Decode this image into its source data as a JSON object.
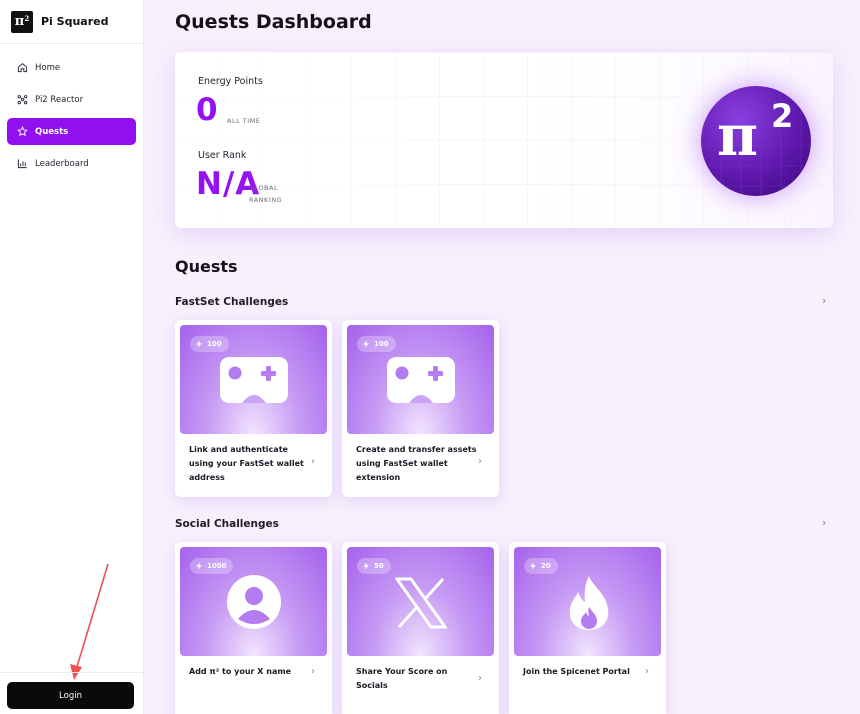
{
  "brand": {
    "logo": "π²",
    "name": "Pi Squared"
  },
  "sidebar": {
    "items": [
      {
        "label": "Home",
        "icon": "home-icon"
      },
      {
        "label": "Pi2 Reactor",
        "icon": "reactor-icon"
      },
      {
        "label": "Quests",
        "icon": "star-icon",
        "active": true
      },
      {
        "label": "Leaderboard",
        "icon": "bar-chart-icon"
      }
    ],
    "login_label": "Login"
  },
  "header": {
    "title": "Quests Dashboard"
  },
  "stats": {
    "energy": {
      "label": "Energy Points",
      "value": "0",
      "sub": "ALL TIME"
    },
    "rank": {
      "label": "User Rank",
      "value": "N/A",
      "sub_line1": "GLOBAL",
      "sub_line2": "RANKING"
    },
    "badge_pi": "π",
    "badge_exp": "2"
  },
  "quests": {
    "title": "Quests",
    "fastset": {
      "title": "FastSet Challenges",
      "cards": [
        {
          "points": "100",
          "icon": "gamepad-icon",
          "text": "Link and authenticate using your FastSet wallet address"
        },
        {
          "points": "100",
          "icon": "gamepad-icon",
          "text": "Create and transfer assets using FastSet wallet extension"
        }
      ]
    },
    "social": {
      "title": "Social Challenges",
      "cards": [
        {
          "points": "1000",
          "icon": "user-icon",
          "text": "Add π² to your X name"
        },
        {
          "points": "50",
          "icon": "x-logo-icon",
          "text": "Share Your Score on Socials"
        },
        {
          "points": "20",
          "icon": "flame-icon",
          "text": "Join the Spicenet Portal"
        }
      ]
    }
  },
  "colors": {
    "accent": "#9010f0",
    "login_bg": "#0a0a0a",
    "background": "#f7f0fd"
  }
}
